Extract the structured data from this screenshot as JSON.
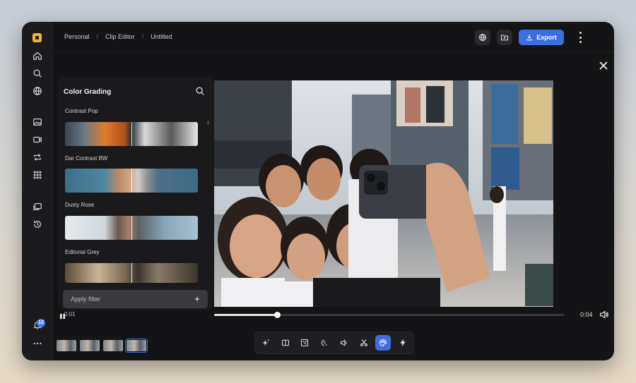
{
  "breadcrumb": {
    "workspace": "Personal",
    "section": "Clip Editor",
    "project": "Untitled",
    "separator": "/"
  },
  "toolbar": {
    "export_label": "Export"
  },
  "panel": {
    "title": "Color Grading",
    "filters": [
      {
        "name": "Contrast Pop"
      },
      {
        "name": "Dar Contrast BW"
      },
      {
        "name": "Dusty Rose"
      },
      {
        "name": "Editorial Grey"
      }
    ],
    "apply_placeholder": "Apply filter"
  },
  "player": {
    "current_time": "0:01",
    "duration": "0:04",
    "progress": 0.18
  },
  "notifications": {
    "count": "12"
  },
  "colors": {
    "accent": "#3b6fe0",
    "logo": "#f2b233",
    "avatar": "#e7908d"
  },
  "sidebar_icons": [
    "home-icon",
    "search-icon",
    "globe-icon",
    "image-icon",
    "video-icon",
    "repeat-icon",
    "grid-icon",
    "layers-icon",
    "history-icon",
    "bell-icon",
    "more-icon"
  ],
  "edit_tools": [
    "sparkle-icon",
    "split-icon",
    "crop-icon",
    "speed-icon",
    "volume-icon",
    "scissors-icon",
    "palette-icon",
    "bolt-icon"
  ]
}
